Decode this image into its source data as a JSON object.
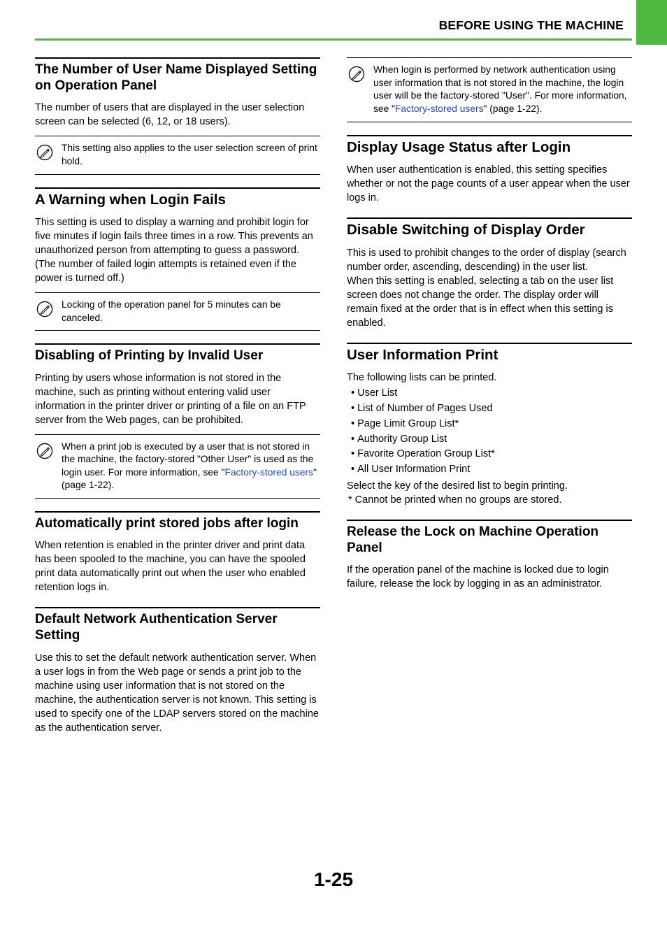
{
  "header": {
    "title": "BEFORE USING THE MACHINE"
  },
  "left": {
    "s1": {
      "title": "The Number of User Name Displayed Setting on Operation Panel",
      "body": "The number of users that are displayed in the user selection screen can be selected (6, 12, or 18 users).",
      "note": "This setting also applies to the user selection screen of print hold."
    },
    "s2": {
      "title": "A Warning when Login Fails",
      "body": "This setting is used to display a warning and prohibit login for five minutes if login fails three times in a row. This prevents an unauthorized person from attempting to guess a password. (The number of failed login attempts is retained even if the power is turned off.)",
      "note": "Locking of the operation panel for 5 minutes can be canceled."
    },
    "s3": {
      "title": "Disabling of Printing by Invalid User",
      "body": "Printing by users whose information is not stored in the machine, such as printing without entering valid user information in the printer driver or printing of a file on an FTP server from the Web pages, can be prohibited.",
      "note_pre": "When a print job is executed by a user that is not stored in the machine, the factory-stored \"Other User\" is used as the login user. For more information, see ",
      "link_text": "Factory-stored users",
      "note_post": " (page 1-22)."
    },
    "s4": {
      "title": "Automatically print stored jobs after login",
      "body": "When retention is enabled in the printer driver and print data has been spooled to the machine, you can have the spooled print data automatically print out when the user who enabled retention logs in."
    },
    "s5": {
      "title": "Default Network Authentication Server Setting",
      "body": "Use this to set the default network authentication server. When a user logs in from the Web page or sends a print job to the machine using user information that is not stored on the machine, the authentication server is not known. This setting is used to specify one of the LDAP servers stored on the machine as the authentication server."
    }
  },
  "right": {
    "top_note": {
      "pre": "When login is performed by network authentication using user information that is not stored in the machine, the login user will be the factory-stored \"User\". For more information, see ",
      "link_text": "Factory-stored users",
      "post": " (page 1-22)."
    },
    "s1": {
      "title": "Display Usage Status after Login",
      "body": "When user authentication is enabled, this setting specifies whether or not the page counts of a user appear when the user logs in."
    },
    "s2": {
      "title": "Disable Switching of Display Order",
      "body1": "This is used to prohibit changes to the order of display (search number order, ascending, descending) in the user list.",
      "body2": "When this setting is enabled, selecting a tab on the user list screen does not change the order. The display order will remain fixed at the order that is in effect when this setting is enabled."
    },
    "s3": {
      "title": "User Information Print",
      "intro": "The following lists can be printed.",
      "items": [
        "User List",
        "List of Number of Pages Used",
        "Page Limit Group List*",
        "Authority Group List",
        "Favorite Operation Group List*",
        "All User Information Print"
      ],
      "after": "Select the key of the desired list to begin printing.",
      "footnote": "*  Cannot be printed when no groups are stored."
    },
    "s4": {
      "title": "Release the Lock on Machine Operation Panel",
      "body": "If the operation panel of the machine is locked due to login failure, release the lock by logging in as an administrator."
    }
  },
  "page_number": "1-25"
}
